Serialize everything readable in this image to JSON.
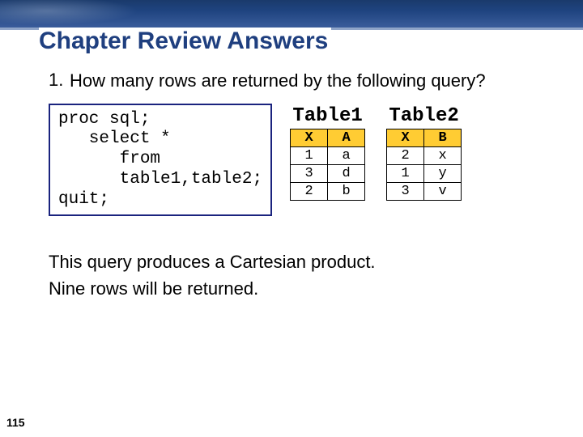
{
  "title": "Chapter Review Answers",
  "question": {
    "number": "1.",
    "text": "How many rows are returned by the following query?"
  },
  "code": "proc sql;\n   select *\n      from\n      table1,table2;\nquit;",
  "tables": [
    {
      "title": "Table1",
      "headers": [
        "X",
        "A"
      ],
      "rows": [
        [
          "1",
          "a"
        ],
        [
          "3",
          "d"
        ],
        [
          "2",
          "b"
        ]
      ]
    },
    {
      "title": "Table2",
      "headers": [
        "X",
        "B"
      ],
      "rows": [
        [
          "2",
          "x"
        ],
        [
          "1",
          "y"
        ],
        [
          "3",
          "v"
        ]
      ]
    }
  ],
  "answer_lines": [
    "This query produces a Cartesian product.",
    "Nine rows will be returned."
  ],
  "page_number": "115"
}
